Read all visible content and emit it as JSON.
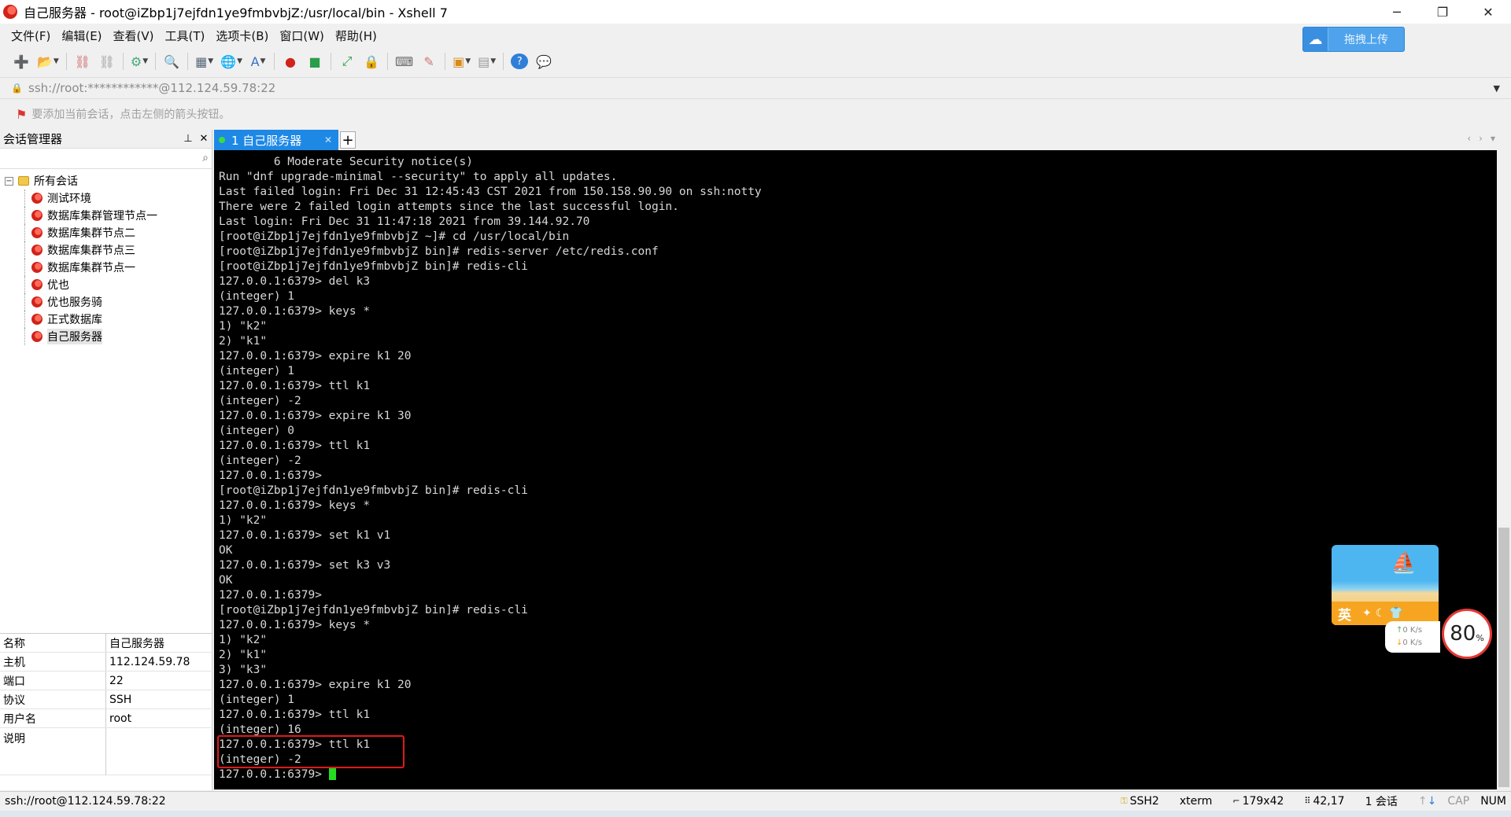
{
  "window": {
    "title": "自己服务器 - root@iZbp1j7ejfdn1ye9fmbvbjZ:/usr/local/bin - Xshell 7",
    "minimize": "─",
    "restore": "❐",
    "close": "✕"
  },
  "menu": [
    "文件(F)",
    "编辑(E)",
    "查看(V)",
    "工具(T)",
    "选项卡(B)",
    "窗口(W)",
    "帮助(H)"
  ],
  "upload_button": {
    "label": "拖拽上传",
    "icon": "cloud-icon"
  },
  "address": {
    "text": "ssh://root:************@112.124.59.78:22"
  },
  "hint": {
    "text": "要添加当前会话，点击左侧的箭头按钮。"
  },
  "session_panel": {
    "title": "会话管理器",
    "pin": "📌",
    "close": "✕",
    "root_label": "所有会话",
    "items": [
      "测试环境",
      "数据库集群管理节点一",
      "数据库集群节点二",
      "数据库集群节点三",
      "数据库集群节点一",
      "优也",
      "优也服务骑",
      "正式数据库",
      "自己服务器"
    ],
    "properties": [
      {
        "key": "名称",
        "value": "自己服务器"
      },
      {
        "key": "主机",
        "value": "112.124.59.78"
      },
      {
        "key": "端口",
        "value": "22"
      },
      {
        "key": "协议",
        "value": "SSH"
      },
      {
        "key": "用户名",
        "value": "root"
      },
      {
        "key": "说明",
        "value": ""
      }
    ]
  },
  "tab": {
    "label": "1 自己服务器",
    "close": "✕",
    "add": "+"
  },
  "terminal": {
    "lines": [
      "        6 Moderate Security notice(s)",
      "Run \"dnf upgrade-minimal --security\" to apply all updates.",
      "Last failed login: Fri Dec 31 12:45:43 CST 2021 from 150.158.90.90 on ssh:notty",
      "There were 2 failed login attempts since the last successful login.",
      "Last login: Fri Dec 31 11:47:18 2021 from 39.144.92.70",
      "[root@iZbp1j7ejfdn1ye9fmbvbjZ ~]# cd /usr/local/bin",
      "[root@iZbp1j7ejfdn1ye9fmbvbjZ bin]# redis-server /etc/redis.conf",
      "[root@iZbp1j7ejfdn1ye9fmbvbjZ bin]# redis-cli",
      "127.0.0.1:6379> del k3",
      "(integer) 1",
      "127.0.0.1:6379> keys *",
      "1) \"k2\"",
      "2) \"k1\"",
      "127.0.0.1:6379> expire k1 20",
      "(integer) 1",
      "127.0.0.1:6379> ttl k1",
      "(integer) -2",
      "127.0.0.1:6379> expire k1 30",
      "(integer) 0",
      "127.0.0.1:6379> ttl k1",
      "(integer) -2",
      "127.0.0.1:6379>",
      "[root@iZbp1j7ejfdn1ye9fmbvbjZ bin]# redis-cli",
      "127.0.0.1:6379> keys *",
      "1) \"k2\"",
      "127.0.0.1:6379> set k1 v1",
      "OK",
      "127.0.0.1:6379> set k3 v3",
      "OK",
      "127.0.0.1:6379>",
      "[root@iZbp1j7ejfdn1ye9fmbvbjZ bin]# redis-cli",
      "127.0.0.1:6379> keys *",
      "1) \"k2\"",
      "2) \"k1\"",
      "3) \"k3\"",
      "127.0.0.1:6379> expire k1 20",
      "(integer) 1",
      "127.0.0.1:6379> ttl k1",
      "(integer) 16",
      "127.0.0.1:6379> ttl k1",
      "(integer) -2"
    ],
    "prompt": "127.0.0.1:6379> "
  },
  "widget": {
    "ime_label": "英",
    "up_speed": "0  K/s",
    "down_speed": "0  K/s",
    "gauge_value": "80",
    "gauge_unit": "%"
  },
  "status": {
    "connection": "ssh://root@112.124.59.78:22",
    "protocol": "SSH2",
    "terminal_type": "xterm",
    "size": "179x42",
    "cursor_pos": "42,17",
    "sessions": "1 会话",
    "cap": "CAP",
    "num": "NUM"
  },
  "colors": {
    "accent": "#1e88e5",
    "highlight": "#e21818",
    "cursor": "#22dd22"
  }
}
